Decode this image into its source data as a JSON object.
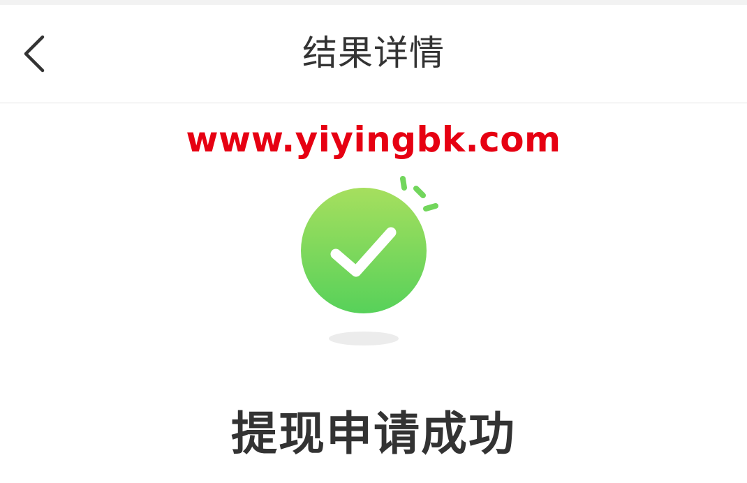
{
  "header": {
    "title": "结果详情",
    "back_icon": "chevron-left-icon"
  },
  "watermark": {
    "text": "www.yiyingbk.com",
    "color": "#e60012"
  },
  "status_icon": {
    "name": "check-circle-icon",
    "colors": {
      "top": "#a6df5e",
      "bottom": "#57d15a",
      "check": "#ffffff",
      "shadow": "#ececec"
    }
  },
  "result": {
    "message": "提现申请成功"
  }
}
